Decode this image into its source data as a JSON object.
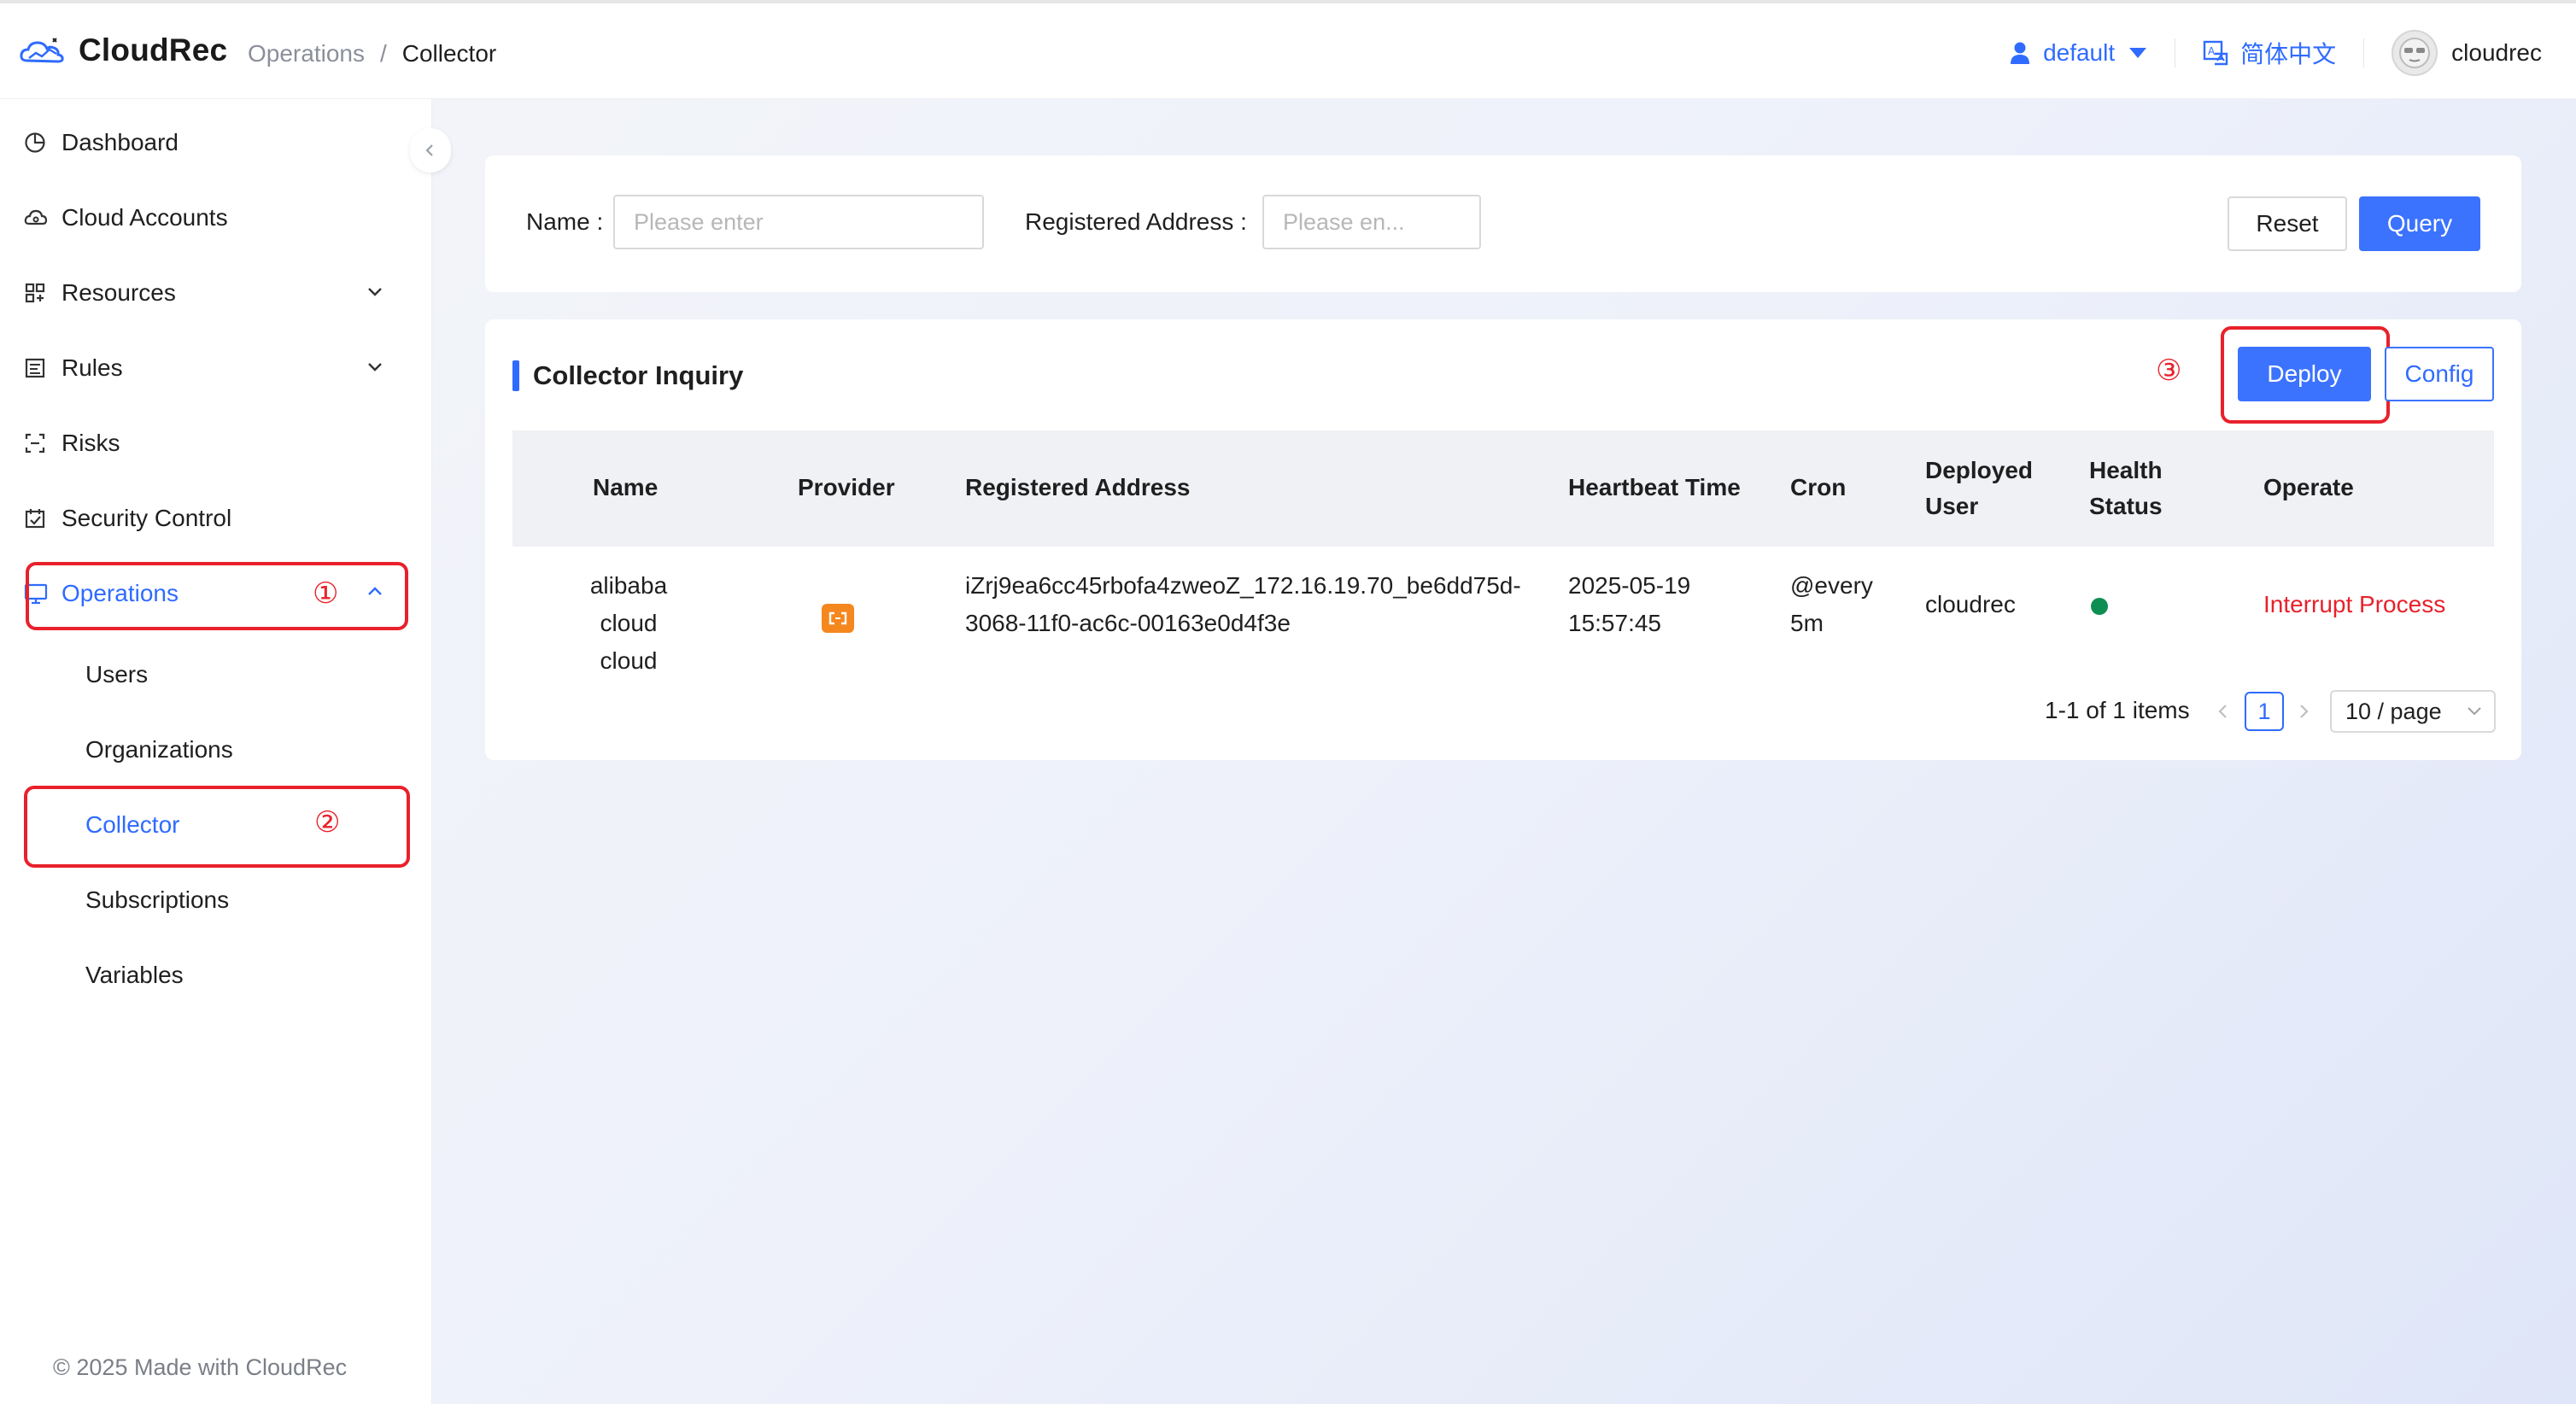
{
  "app": {
    "name": "CloudRec"
  },
  "breadcrumb": {
    "parent": "Operations",
    "separator": "/",
    "current": "Collector"
  },
  "header": {
    "tenant": "default",
    "language": "简体中文",
    "user": "cloudrec"
  },
  "sidebar": {
    "items": [
      {
        "label": "Dashboard",
        "icon": "dashboard-icon"
      },
      {
        "label": "Cloud Accounts",
        "icon": "cloud-icon"
      },
      {
        "label": "Resources",
        "icon": "resources-icon"
      },
      {
        "label": "Rules",
        "icon": "rules-icon"
      },
      {
        "label": "Risks",
        "icon": "risks-icon"
      },
      {
        "label": "Security Control",
        "icon": "security-icon"
      },
      {
        "label": "Operations",
        "icon": "monitor-icon"
      }
    ],
    "sub_items": [
      {
        "label": "Users"
      },
      {
        "label": "Organizations"
      },
      {
        "label": "Collector"
      },
      {
        "label": "Subscriptions"
      },
      {
        "label": "Variables"
      }
    ],
    "footer": "© 2025 Made with CloudRec"
  },
  "annotations": {
    "one": "①",
    "two": "②",
    "three": "③"
  },
  "filter": {
    "name_label": "Name",
    "name_placeholder": "Please enter",
    "address_label": "Registered Address",
    "address_placeholder": "Please en...",
    "reset_label": "Reset",
    "query_label": "Query"
  },
  "table_card": {
    "title": "Collector Inquiry",
    "deploy_label": "Deploy",
    "config_label": "Config",
    "columns": [
      {
        "l1": "Name",
        "l2": ""
      },
      {
        "l1": "Provider",
        "l2": ""
      },
      {
        "l1": "Registered Address",
        "l2": ""
      },
      {
        "l1": "Heartbeat Time",
        "l2": ""
      },
      {
        "l1": "Cron",
        "l2": ""
      },
      {
        "l1": "Deployed",
        "l2": "User"
      },
      {
        "l1": "Health",
        "l2": "Status"
      },
      {
        "l1": "Operate",
        "l2": ""
      }
    ],
    "rows": [
      {
        "name_l1": "alibaba cloud",
        "name_l2": "cloud",
        "provider_icon": "alibaba-cloud-icon",
        "address_l1": "iZrj9ea6cc45rbofa4zweoZ_172.16.19.70_be6dd75d-",
        "address_l2": "3068-11f0-ac6c-00163e0d4f3e",
        "heartbeat_l1": "2025-05-19",
        "heartbeat_l2": "15:57:45",
        "cron_l1": "@every",
        "cron_l2": "5m",
        "deployed_user": "cloudrec",
        "health_color": "#0e8f52",
        "operate": "Interrupt Process"
      }
    ]
  },
  "pagination": {
    "summary": "1-1 of 1 items",
    "current_page": "1",
    "page_size": "10 / page"
  },
  "colors": {
    "accent": "#2f6bff",
    "danger": "#e8212b",
    "provider": "#f5871f",
    "healthy": "#0e8f52"
  }
}
